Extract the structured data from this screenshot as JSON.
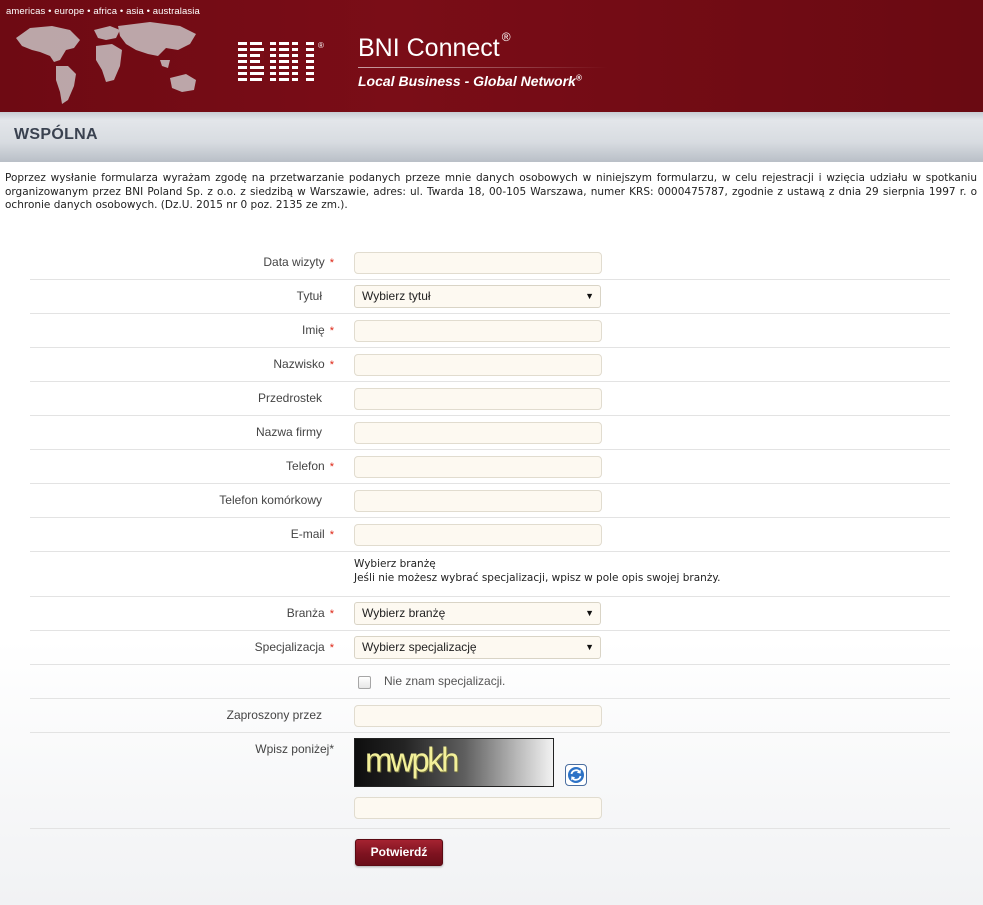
{
  "header": {
    "regions": "americas • europe • africa • asia • australasia",
    "logo_text": "BNI",
    "title": "BNI Connect",
    "title_mark": "®",
    "subtitle": "Local Business - Global Network",
    "subtitle_mark": "®",
    "icons": {
      "map": "world-map-icon"
    }
  },
  "section": {
    "title": "WSPÓLNA"
  },
  "consent_text": "Poprzez wysłanie formularza wyrażam zgodę na przetwarzanie podanych przeze mnie danych osobowych w niniejszym formularzu, w celu rejestracji i wzięcia udziału w spotkaniu organizowanym przez BNI Poland Sp. z o.o. z siedzibą w Warszawie, adres: ul. Twarda 18, 00-105 Warszawa, numer KRS: 0000475787, zgodnie z ustawą z dnia 29 sierpnia 1997 r. o ochronie danych osobowych. (Dz.U. 2015 nr 0 poz. 2135 ze zm.).",
  "form": {
    "required_mark": "*",
    "visit_date": {
      "label": "Data wizyty",
      "value": ""
    },
    "title": {
      "label": "Tytuł",
      "selected": "Wybierz tytuł"
    },
    "first_name": {
      "label": "Imię",
      "value": ""
    },
    "last_name": {
      "label": "Nazwisko",
      "value": ""
    },
    "prefix": {
      "label": "Przedrostek",
      "value": ""
    },
    "company": {
      "label": "Nazwa firmy",
      "value": ""
    },
    "phone": {
      "label": "Telefon",
      "value": ""
    },
    "mobile": {
      "label": "Telefon komórkowy",
      "value": ""
    },
    "email": {
      "label": "E-mail",
      "value": ""
    },
    "industry_info": {
      "line1": "Wybierz branżę",
      "line2": "Jeśli nie możesz wybrać specjalizacji, wpisz w pole opis swojej branży."
    },
    "industry": {
      "label": "Branża",
      "selected": "Wybierz branżę"
    },
    "specialization": {
      "label": "Specjalizacja",
      "selected": "Wybierz specjalizację"
    },
    "unknown_specialization": {
      "label": "Nie znam specjalizacji.",
      "checked": false
    },
    "invited_by": {
      "label": "Zaproszony przez",
      "value": ""
    },
    "captcha": {
      "label": "Wpisz poniżej",
      "image_text": "mwpkh",
      "value": ""
    },
    "submit_label": "Potwierdź"
  }
}
